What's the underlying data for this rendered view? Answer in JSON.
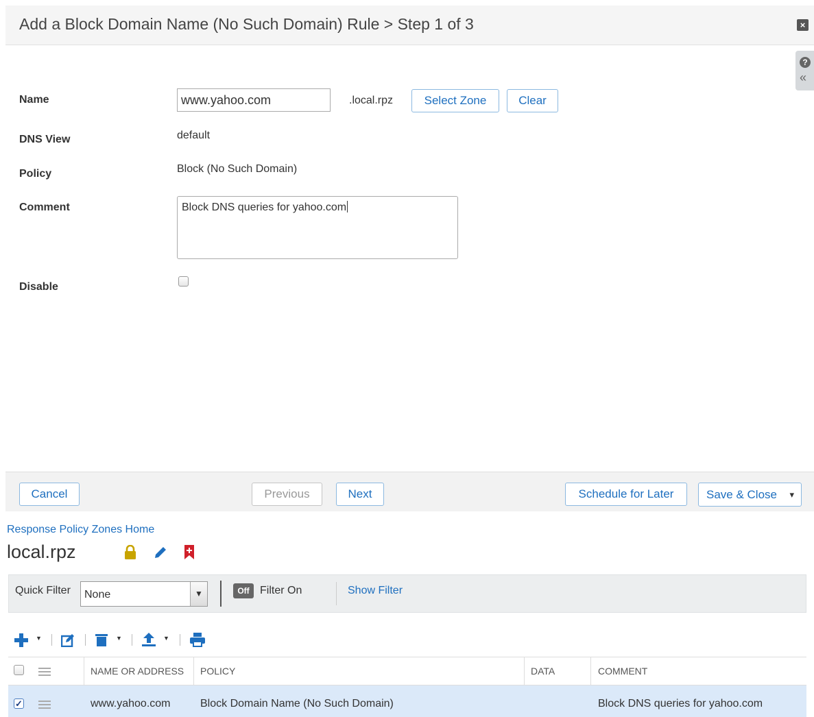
{
  "dialog": {
    "title": "Add a Block Domain Name (No Such Domain) Rule > Step 1 of 3",
    "close_symbol": "×",
    "help_symbol": "?",
    "collapse_symbol": "«"
  },
  "form": {
    "name_label": "Name",
    "name_value": "www.yahoo.com",
    "zone_suffix": ".local.rpz",
    "select_zone_label": "Select Zone",
    "clear_label": "Clear",
    "dns_view_label": "DNS View",
    "dns_view_value": "default",
    "policy_label": "Policy",
    "policy_value": "Block (No Such Domain)",
    "comment_label": "Comment",
    "comment_value": "Block DNS queries for yahoo.com",
    "disable_label": "Disable",
    "disable_checked": false
  },
  "footer": {
    "cancel_label": "Cancel",
    "previous_label": "Previous",
    "next_label": "Next",
    "schedule_label": "Schedule for Later",
    "save_close_label": "Save & Close",
    "save_close_arrow": "▾"
  },
  "background_page": {
    "breadcrumb": "Response Policy Zones Home",
    "zone_title": "local.rpz",
    "icons": [
      "lock-icon",
      "edit-pencil-icon",
      "bookmark-icon"
    ],
    "filter_bar": {
      "quick_filter_label": "Quick Filter",
      "quick_filter_value": "None",
      "toggle_label": "Off",
      "filter_on_label": "Filter On",
      "show_filter_label": "Show Filter"
    },
    "toolbar": [
      "add-icon",
      "edit-icon",
      "delete-icon",
      "export-icon",
      "print-icon"
    ],
    "table": {
      "columns": [
        "NAME OR ADDRESS",
        "POLICY",
        "DATA",
        "COMMENT"
      ],
      "rows": [
        {
          "checked": true,
          "name": "www.yahoo.com",
          "policy": "Block Domain Name (No Such Domain)",
          "data": "",
          "comment": "Block DNS queries for yahoo.com"
        }
      ]
    }
  },
  "colors": {
    "link_blue": "#1e6fbf",
    "lock_yellow": "#c8a400",
    "bookmark_red": "#d0202a",
    "selected_row": "#dbe9f9"
  }
}
